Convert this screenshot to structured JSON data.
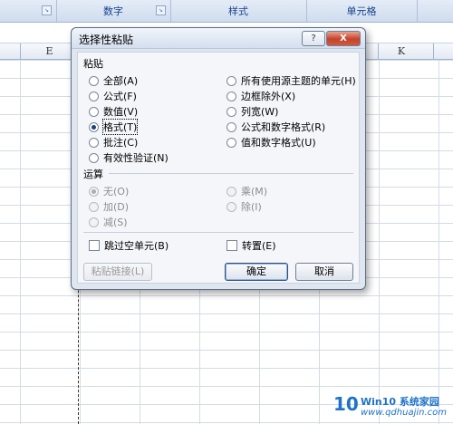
{
  "ribbon": {
    "groups": [
      "数字",
      "样式",
      "单元格"
    ]
  },
  "columns": [
    "E",
    "K"
  ],
  "dialog": {
    "title": "选择性粘贴",
    "help_label": "?",
    "close_label": "X",
    "paste_section": "粘贴",
    "paste_options_left": [
      "全部(A)",
      "公式(F)",
      "数值(V)",
      "格式(T)",
      "批注(C)",
      "有效性验证(N)"
    ],
    "paste_options_right": [
      "所有使用源主题的单元(H)",
      "边框除外(X)",
      "列宽(W)",
      "公式和数字格式(R)",
      "值和数字格式(U)"
    ],
    "selected_paste": "格式(T)",
    "operation_section": "运算",
    "operation_left": [
      "无(O)",
      "加(D)",
      "减(S)"
    ],
    "operation_right": [
      "乘(M)",
      "除(I)"
    ],
    "selected_operation": "无(O)",
    "skip_blanks": "跳过空单元(B)",
    "transpose": "转置(E)",
    "paste_link": "粘贴链接(L)",
    "ok": "确定",
    "cancel": "取消"
  },
  "watermark": {
    "logo": "10",
    "site": "Win10 系统家园",
    "url": "www.qdhuajin.com"
  }
}
